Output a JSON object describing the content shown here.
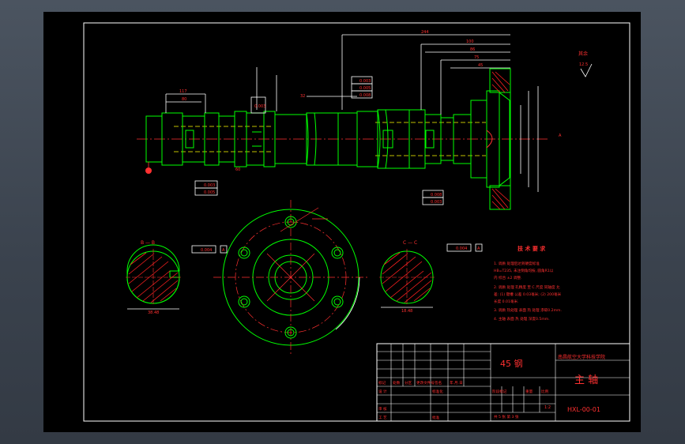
{
  "colors": {
    "background": "#3d4550",
    "paper": "#000000",
    "frame": "#ffffff",
    "geometry": "#00ff00",
    "dimension": "#ff3030",
    "annotation": "#ffffff",
    "centerline": "#ffff00",
    "hatch": "#ff2020"
  },
  "drawing": {
    "material": "45 钢",
    "company": "南昌航空大学科技学院",
    "part_name": "主 轴",
    "drawing_no": "HXL-00-01",
    "scale": "1:2",
    "sheet_info": "共 5 张  第 3 张",
    "roughness_label": "其余",
    "roughness_value": "12.5"
  },
  "title_block": {
    "row_labels": [
      "标记",
      "处数",
      "分区",
      "更改文件号",
      "签名",
      "年.月.日"
    ],
    "design_label": "设 计",
    "standard_label": "标准化",
    "review_label": "审 核",
    "process_label": "工 艺",
    "approve_label": "批准",
    "stage_label": "阶段标记",
    "weight_label": "重量",
    "scale_label": "比例"
  },
  "tech_req": {
    "title": "技 术 要 求",
    "lines": [
      "1. 调质 处理后达到硬度标准",
      "HB=T235, 未注倒角均按, 圆角R1以",
      "内 综合 ±2 调整.",
      "2. 调质 处理 孔精度 至  C 尺度 同轴度 允",
      "  差: (1) 键槽 公差 0.03毫米; (2) 200毫米",
      "  长度 0.01毫米.",
      "3. 调质 热处理 表面 热 处理 渗碳0.2mm.",
      "4. 主轴 表面 热 处理 深度0.5mm."
    ]
  },
  "section_labels": {
    "section_b": "B — B",
    "section_c": "C — C",
    "section_b_width": "38.48",
    "section_c_width": "18.48",
    "tol_b": "0.004",
    "tol_c": "0.004",
    "datum_b": "A",
    "datum_c": "A"
  },
  "dimension_texts": [
    "244",
    "100",
    "86",
    "75",
    "45",
    "117",
    "80",
    "32",
    "60",
    "A"
  ],
  "tolerance_boxes": [
    "0.003",
    "0.005",
    "0.008",
    "0.003",
    "0.005",
    "0.008",
    "0.003",
    "0.003"
  ]
}
